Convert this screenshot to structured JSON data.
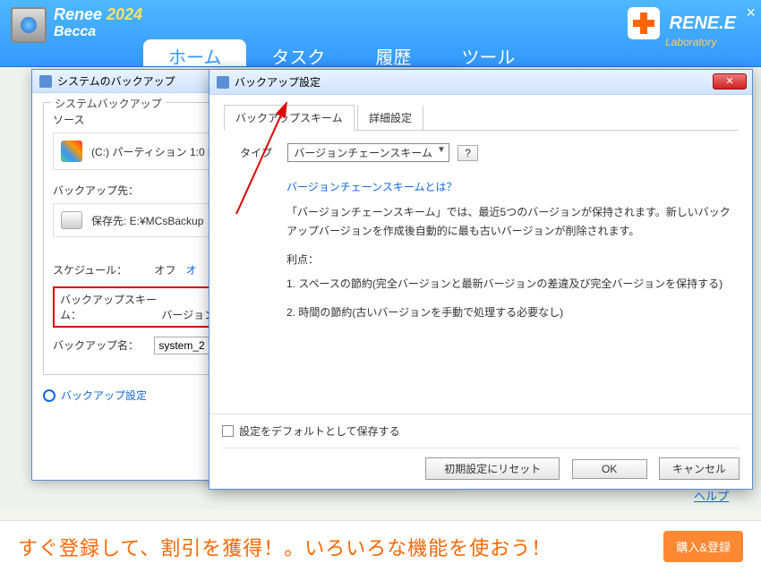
{
  "header": {
    "app_name": "Renee",
    "year": "2024",
    "subtitle": "Becca",
    "brand": "RENE.E",
    "brand_sub": "Laboratory",
    "tabs": [
      "ホーム",
      "タスク",
      "履歴",
      "ツール"
    ]
  },
  "dlg1": {
    "title": "システムのバックアップ",
    "group_label": "システムバックアップ",
    "source_label": "ソース",
    "source_text": "(C:) パーティション 1:0 [",
    "dest_label": "バックアップ先：",
    "dest_text": "保存先: E:¥MCsBackup",
    "schedule_label": "スケジュール：",
    "schedule_off": "オフ",
    "schedule_on_link": "オ",
    "scheme_label": "バックアップスキーム：",
    "scheme_value": "バージョン",
    "name_label": "バックアップ名：",
    "name_value": "system_2",
    "settings_link": "バックアップ設定"
  },
  "dlg2": {
    "title": "バックアップ設定",
    "subtabs": [
      "バックアップスキーム",
      "詳細設定"
    ],
    "type_label": "タイプ",
    "type_value": "バージョンチェーンスキーム",
    "help_q": "?",
    "desc_q": "バージョンチェーンスキームとは？",
    "desc_p": "「バージョンチェーンスキーム」では、最近5つのバージョンが保持されます。新しいバックアップバージョンを作成後自動的に最も古いバージョンが削除されます。",
    "adv_label": "利点：",
    "adv1": "1. スペースの節約(完全バージョンと最新バージョンの差違及び完全バージョンを保持する)",
    "adv2": "2. 時間の節約(古いバージョンを手動で処理する必要なし)",
    "save_default": "設定をデフォルトとして保存する",
    "btn_reset": "初期設定にリセット",
    "btn_ok": "OK",
    "btn_cancel": "キャンセル"
  },
  "misc": {
    "help_link": "ヘルプ",
    "promo": "すぐ登録して、割引を獲得！。いろいろな機能を使おう！",
    "buy": "購入&登録"
  }
}
